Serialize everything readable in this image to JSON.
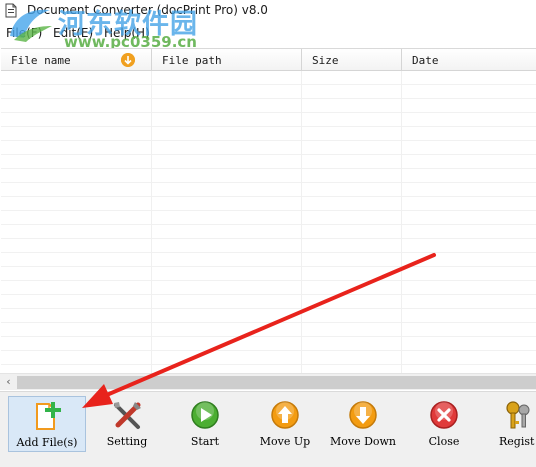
{
  "window": {
    "title": "Document Converter (docPrint Pro) v8.0",
    "app_icon": "document-icon"
  },
  "menu": {
    "items": [
      {
        "label": "File(F)"
      },
      {
        "label": "Edit(E)"
      },
      {
        "label": "Help(H)"
      }
    ]
  },
  "watermark": {
    "text_cn": "河东软件园",
    "url": "www.pc0359.cn"
  },
  "table": {
    "columns": [
      {
        "label": "File name"
      },
      {
        "label": "File path"
      },
      {
        "label": "Size"
      },
      {
        "label": "Date"
      }
    ],
    "sort_icon": "sort-down-icon",
    "rows": []
  },
  "toolbar": {
    "buttons": [
      {
        "label": "Add File(s)",
        "icon": "add-file-icon"
      },
      {
        "label": "Setting",
        "icon": "tools-icon"
      },
      {
        "label": "Start",
        "icon": "play-icon"
      },
      {
        "label": "Move Up",
        "icon": "arrow-up-icon"
      },
      {
        "label": "Move Down",
        "icon": "arrow-down-icon"
      },
      {
        "label": "Close",
        "icon": "close-icon"
      },
      {
        "label": "Regist",
        "icon": "keys-icon"
      }
    ]
  },
  "colors": {
    "annotation_arrow": "#e8231c",
    "toolbar_bg": "#f0f0f0",
    "active_button_bg": "#d9e8f7"
  }
}
